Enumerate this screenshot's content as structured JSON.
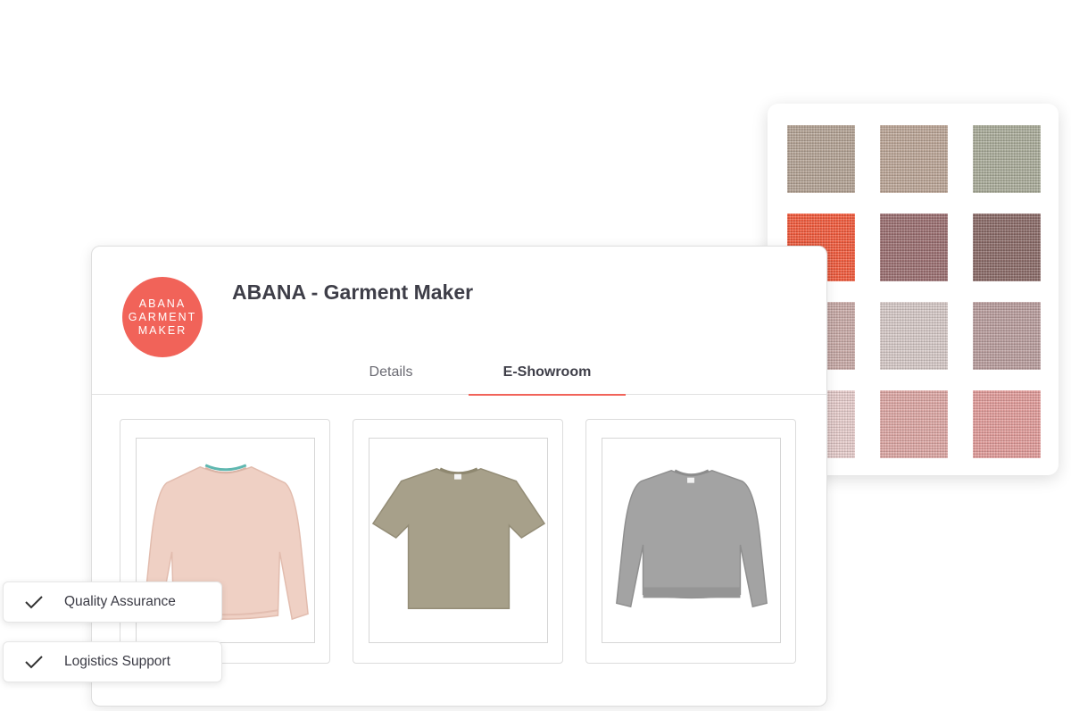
{
  "company": {
    "logo_lines": [
      "ABANA",
      "GARMENT",
      "MAKER"
    ],
    "name": "ABANA - Garment Maker"
  },
  "tabs": [
    {
      "label": "Details",
      "active": false
    },
    {
      "label": "E-Showroom",
      "active": true
    }
  ],
  "products": [
    {
      "icon": "pink-sweatshirt-image",
      "color": "#efd0c4"
    },
    {
      "icon": "olive-tshirt-image",
      "color": "#a7a08a"
    },
    {
      "icon": "gray-sweatshirt-image",
      "color": "#a3a3a3"
    }
  ],
  "features": [
    {
      "label": "Quality Assurance",
      "icon": "check-icon"
    },
    {
      "label": "Logistics Support",
      "icon": "check-icon"
    }
  ],
  "swatches": [
    "#b3a294",
    "#bba596",
    "#a9ab99",
    "#f05a3c",
    "#9a6e70",
    "#8a6a67",
    "#c8a9a6",
    "#d5c8c6",
    "#b89c9c",
    "#e6cccb",
    "#dca6a3",
    "#e09b99"
  ],
  "colors": {
    "brand": "#f16359",
    "tab_underline": "#f16359",
    "check": "#333333"
  }
}
